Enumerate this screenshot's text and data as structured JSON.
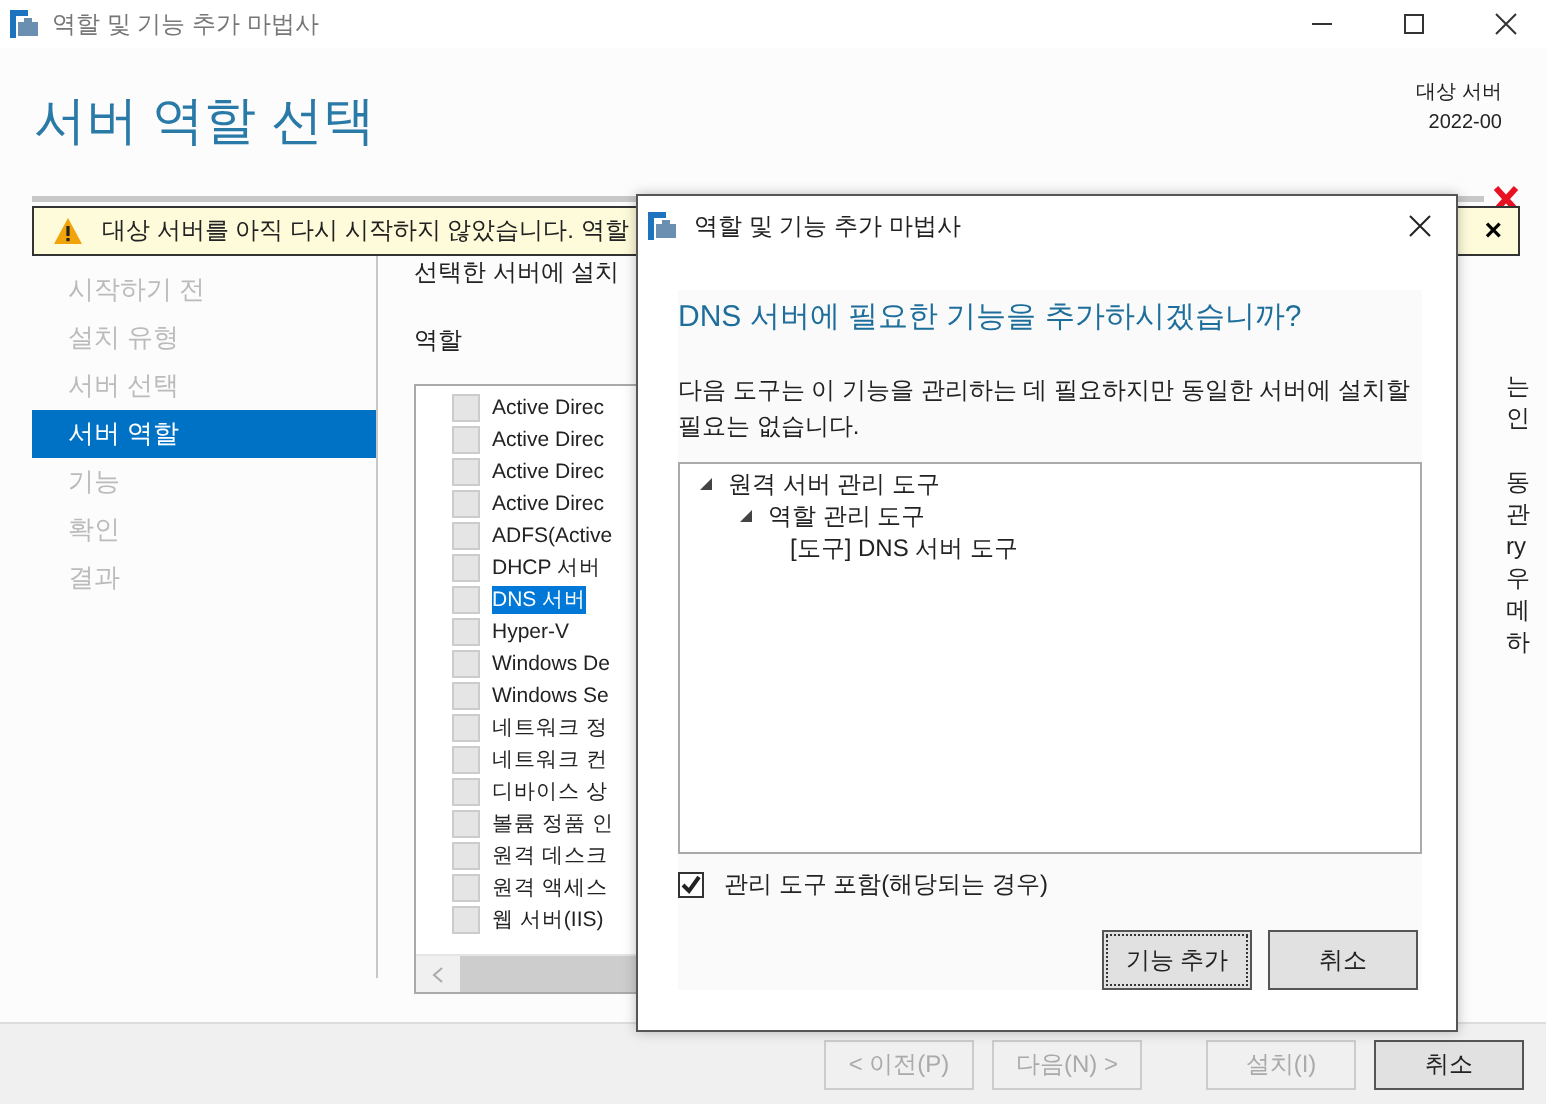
{
  "window": {
    "title": "역할 및 기능 추가 마법사"
  },
  "header": {
    "title": "서버 역할 선택",
    "target_label": "대상 서버",
    "target_server": "2022-00"
  },
  "warning": {
    "message": "대상 서버를 아직 다시 시작하지 않았습니다. 역할",
    "close": "×"
  },
  "nav": [
    {
      "label": "시작하기 전",
      "selected": false
    },
    {
      "label": "설치 유형",
      "selected": false
    },
    {
      "label": "서버 선택",
      "selected": false
    },
    {
      "label": "서버 역할",
      "selected": true
    },
    {
      "label": "기능",
      "selected": false
    },
    {
      "label": "확인",
      "selected": false
    },
    {
      "label": "결과",
      "selected": false
    }
  ],
  "content": {
    "intro": "선택한 서버에 설치",
    "roles_label": "역할",
    "roles": [
      {
        "label": "Active Direc",
        "checked": false,
        "selected": false
      },
      {
        "label": "Active Direc",
        "checked": false,
        "selected": false
      },
      {
        "label": "Active Direc",
        "checked": false,
        "selected": false
      },
      {
        "label": "Active Direc",
        "checked": false,
        "selected": false
      },
      {
        "label": "ADFS(Active",
        "checked": false,
        "selected": false
      },
      {
        "label": "DHCP 서버",
        "checked": false,
        "selected": false
      },
      {
        "label": "DNS 서버",
        "checked": false,
        "selected": true
      },
      {
        "label": "Hyper-V",
        "checked": false,
        "selected": false
      },
      {
        "label": "Windows De",
        "checked": false,
        "selected": false
      },
      {
        "label": "Windows Se",
        "checked": false,
        "selected": false
      },
      {
        "label": "네트워크 정",
        "checked": false,
        "selected": false
      },
      {
        "label": "네트워크 컨",
        "checked": false,
        "selected": false
      },
      {
        "label": "디바이스 상",
        "checked": false,
        "selected": false
      },
      {
        "label": "볼륨 정품 인",
        "checked": false,
        "selected": false
      },
      {
        "label": "원격 데스크",
        "checked": false,
        "selected": false
      },
      {
        "label": "원격 액세스",
        "checked": false,
        "selected": false
      },
      {
        "label": "웹 서버(IIS)",
        "checked": false,
        "selected": false
      }
    ],
    "description_paragraphs": [
      {
        "lines": [
          "는",
          "인"
        ]
      },
      {
        "lines": [
          "동",
          "관",
          "ry",
          "우",
          "메",
          "하"
        ]
      }
    ]
  },
  "footer": {
    "buttons": [
      {
        "label": "< 이전(P)",
        "disabled": true
      },
      {
        "label": "다음(N) >",
        "disabled": true
      },
      {
        "label": "설치(I)",
        "disabled": true
      },
      {
        "label": "취소",
        "disabled": false
      }
    ]
  },
  "dialog": {
    "title": "역할 및 기능 추가 마법사",
    "question": "DNS 서버에 필요한 기능을 추가하시겠습니까?",
    "description": "다음 도구는 이 기능을 관리하는 데 필요하지만 동일한 서버에 설치할 필요는 없습니다.",
    "tree": [
      {
        "label": "원격 서버 관리 도구",
        "expanded": true,
        "children": [
          {
            "label": "역할 관리 도구",
            "expanded": true,
            "children": [
              {
                "label": "[도구] DNS 서버 도구"
              }
            ]
          }
        ]
      }
    ],
    "include_tools": {
      "label": "관리 도구 포함(해당되는 경우)",
      "checked": true
    },
    "buttons": [
      {
        "label": "기능 추가",
        "focused": true
      },
      {
        "label": "취소",
        "focused": false
      }
    ]
  }
}
